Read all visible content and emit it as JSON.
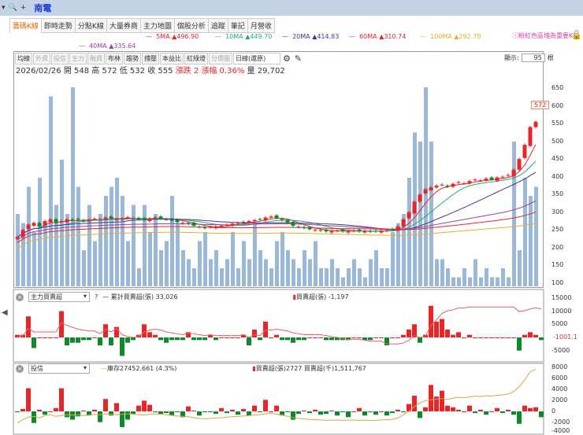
{
  "header": {
    "stock_name": "南電",
    "search_icon": "magnifier-icon",
    "add_label": "+"
  },
  "tabs": [
    "籌碼K線",
    "即時走勢",
    "分點K線",
    "大量券商",
    "主力地圖",
    "個股分析",
    "追蹤",
    "筆記",
    "月營收"
  ],
  "ma_legend": [
    {
      "label": "5MA ▲496.90",
      "color": "#e8262a"
    },
    {
      "label": "10MA ▲449.70",
      "color": "#2aa876"
    },
    {
      "label": "20MA ▲414.83",
      "color": "#3a3a9a"
    },
    {
      "label": "60MA ▲310.74",
      "color": "#e8262a"
    },
    {
      "label": "100MA ▲292.78",
      "color": "#e6b030"
    },
    {
      "label": "40MA ▲335.64",
      "color": "#a040a0"
    }
  ],
  "notice": "ⓘ粉紅色區塊為重要K棒",
  "toolbar": {
    "buttons": [
      "均線",
      "外資",
      "投信",
      "主力",
      "融資",
      "布林",
      "趨勢",
      "撐壓",
      "本益比",
      "紅綠燈",
      "分價圖"
    ],
    "dim": [
      1,
      2,
      3,
      4,
      10
    ],
    "period": "日線(還原)",
    "display_label": "顯示:",
    "display_value": "95",
    "display_unit": "根"
  },
  "quote": {
    "date": "2026/02/26",
    "open": "開 548",
    "high": "高 572",
    "low": "低 532",
    "close": "收 555",
    "change": "漲跌 2",
    "pct": "漲幅 0.36%",
    "volume": "量 29,702"
  },
  "price_axis": [
    "650",
    "600",
    "550",
    "500",
    "450",
    "400",
    "350",
    "300",
    "250",
    "200",
    "150",
    "100"
  ],
  "price_marker": "572",
  "chart_data": {
    "type": "candlestick",
    "ylim": [
      100,
      650
    ],
    "close": [
      230,
      250,
      265,
      270,
      260,
      275,
      280,
      270,
      275,
      280,
      278,
      280,
      275,
      278,
      282,
      280,
      285,
      283,
      280,
      282,
      286,
      284,
      280,
      278,
      282,
      285,
      283,
      280,
      276,
      272,
      270,
      268,
      262,
      258,
      255,
      258,
      260,
      262,
      265,
      268,
      270,
      272,
      275,
      278,
      280,
      285,
      288,
      284,
      278,
      270,
      262,
      258,
      255,
      252,
      250,
      248,
      246,
      247,
      248,
      246,
      247,
      248,
      246,
      247,
      245,
      246,
      248,
      250,
      252,
      260,
      280,
      300,
      330,
      350,
      365,
      370,
      375,
      378,
      372,
      380,
      385,
      382,
      388,
      392,
      390,
      395,
      392,
      398,
      400,
      405,
      420,
      450,
      490,
      540,
      555
    ],
    "volume_level": [
      40,
      35,
      55,
      30,
      60,
      35,
      105,
      45,
      70,
      40,
      110,
      55,
      20,
      45,
      25,
      40,
      50,
      55,
      60,
      50,
      25,
      45,
      10,
      45,
      30,
      40,
      20,
      25,
      50,
      35,
      20,
      15,
      10,
      25,
      30,
      15,
      20,
      10,
      15,
      30,
      10,
      25,
      15,
      35,
      20,
      15,
      10,
      25,
      30,
      20,
      15,
      10,
      20,
      15,
      25,
      10,
      10,
      15,
      10,
      5,
      10,
      15,
      10,
      5,
      15,
      20,
      10,
      10,
      30,
      35,
      40,
      60,
      85,
      80,
      110,
      80,
      15,
      15,
      10,
      5,
      5,
      10,
      5,
      15,
      5,
      10,
      5,
      5,
      10,
      5,
      80,
      20,
      60,
      50,
      55
    ]
  },
  "panel2": {
    "selector": "主力買賣超",
    "help": "?",
    "cum_label": "累計買賣超(張) 33,026",
    "bar_label": "買賣超(張) -1,197",
    "axis": [
      "15000",
      "10000",
      "5000",
      "-5000"
    ],
    "marker": "-1001.1",
    "bars": [
      1,
      1,
      8,
      -4,
      0,
      0,
      0,
      0,
      10,
      -3,
      -2,
      -2,
      -1,
      -1,
      0,
      -3,
      5,
      -3,
      4,
      -7,
      -2,
      -1,
      1,
      5,
      2,
      1,
      -1,
      -2,
      -1,
      -1,
      -1,
      2,
      -1,
      -1,
      -1,
      1,
      -1,
      0,
      0,
      0,
      0,
      1,
      -3,
      3,
      -1,
      6,
      0,
      1,
      -1,
      -1,
      -2,
      -1,
      -1,
      0,
      0,
      0,
      -1,
      -1,
      -1,
      -1,
      -1,
      0,
      0,
      -1,
      -1,
      0,
      0,
      -3,
      0,
      0,
      1,
      3,
      5,
      -2,
      1,
      12,
      6,
      7,
      3,
      1,
      2,
      0,
      1,
      0,
      0,
      0,
      0,
      0,
      0,
      0,
      0,
      -5,
      1,
      2,
      1,
      -1
    ]
  },
  "panel3": {
    "selector": "投信",
    "inv_label": "庫存27452.661 (4.3%)",
    "bar_label": "買賣超(張)2727 買賣超(千)1,511,767",
    "axis": [
      "8000",
      "6000",
      "4000",
      "2000",
      "0",
      "-2000",
      "-4000"
    ]
  },
  "nav_left_icon": "triangle-left-icon"
}
